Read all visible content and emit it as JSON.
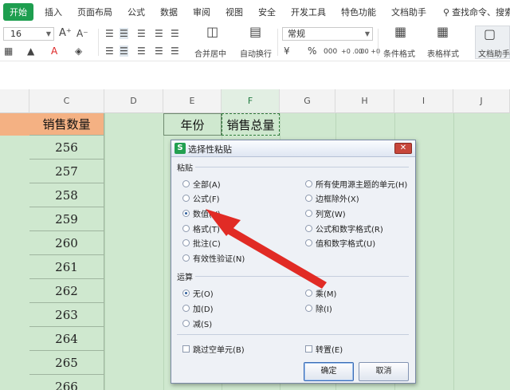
{
  "menu": {
    "start": "开始",
    "insert": "插入",
    "page_layout": "页面布局",
    "formula": "公式",
    "data": "数据",
    "review": "审阅",
    "view": "视图",
    "security": "安全",
    "developer": "开发工具",
    "features": "特色功能",
    "doc_assistant": "文档助手",
    "search": "查找命令、搜索..."
  },
  "toolbar": {
    "font_size": "16",
    "merge_center": "合并居中",
    "wrap_text": "自动换行",
    "number_format": "常规",
    "percent": "%",
    "thousands": "000",
    "inc_decimal": "+0 .00",
    "dec_decimal": ".00 +0",
    "cond_format": "条件格式",
    "table_style": "表格样式",
    "doc_assistant": "文档助手"
  },
  "sheet": {
    "columns": [
      "C",
      "D",
      "E",
      "F",
      "G",
      "H",
      "I",
      "J"
    ],
    "c_header": "销售数量",
    "c_values": [
      "256",
      "257",
      "258",
      "259",
      "260",
      "261",
      "262",
      "263",
      "264",
      "265",
      "266"
    ],
    "e_header": "年份",
    "f_header": "销售总量"
  },
  "dialog": {
    "title": "选择性粘贴",
    "paste_group": "粘贴",
    "paste_left": [
      "全部(A)",
      "公式(F)",
      "数值(V)",
      "格式(T)",
      "批注(C)",
      "有效性验证(N)"
    ],
    "paste_right": [
      "所有使用源主题的单元(H)",
      "边框除外(X)",
      "列宽(W)",
      "公式和数字格式(R)",
      "值和数字格式(U)"
    ],
    "operation_group": "运算",
    "op_left": [
      "无(O)",
      "加(D)",
      "减(S)"
    ],
    "op_right": [
      "乘(M)",
      "除(I)"
    ],
    "skip_blanks": "跳过空单元(B)",
    "transpose": "转置(E)",
    "ok": "确定",
    "cancel": "取消",
    "selected_paste": "数值(V)",
    "selected_op": "无(O)"
  },
  "colors": {
    "accent": "#1e9e4f",
    "sheet_bg": "#cfe8cf",
    "header_fill": "#f4b183",
    "arrow": "#e12b25"
  }
}
